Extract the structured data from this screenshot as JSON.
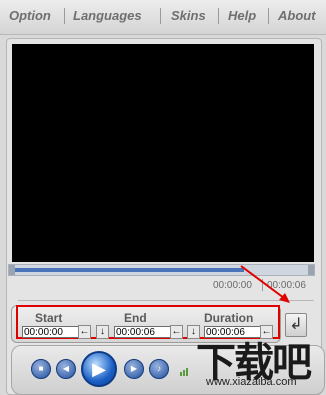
{
  "menu": {
    "items": [
      "Option",
      "Languages",
      "Skins",
      "Help",
      "About"
    ]
  },
  "playback": {
    "current_time": "00:00:00",
    "total_time": "00:00:06",
    "seek_progress": 0.77
  },
  "trim": {
    "start_label": "Start",
    "end_label": "End",
    "duration_label": "Duration",
    "start_value": "00:00:00",
    "end_value": "00:00:06",
    "duration_value": "00:00:06",
    "set_button_glyph": "←",
    "down_button_glyph": "↓"
  },
  "enter_button": {
    "glyph": "↲"
  },
  "watermark": {
    "text": "下载吧",
    "url": "www.xiazaiba.com"
  },
  "colors": {
    "highlight": "#e00000",
    "seek_fill": "#4a73b8",
    "transport_blue": "#1f4f9f"
  }
}
